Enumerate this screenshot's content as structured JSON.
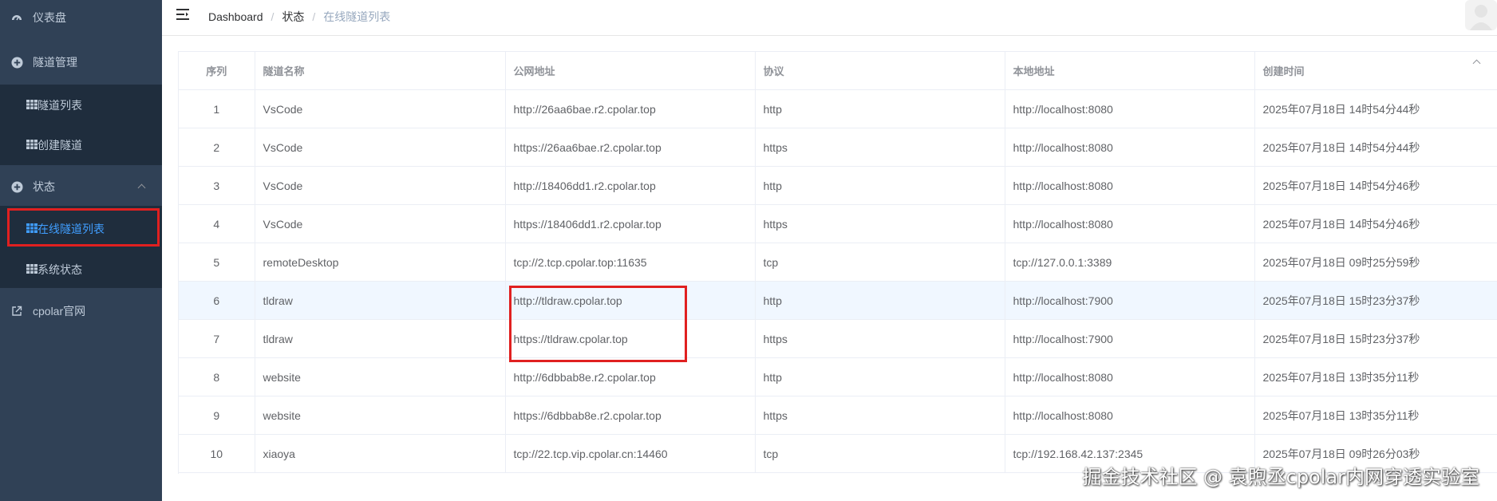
{
  "sidebar": {
    "dashboard": "仪表盘",
    "tunnel_mgmt": "隧道管理",
    "tunnel_list": "隧道列表",
    "create_tunnel": "创建隧道",
    "status": "状态",
    "online_tunnels": "在线隧道列表",
    "system_status": "系统状态",
    "official_site": "cpolar官网"
  },
  "breadcrumb": [
    "Dashboard",
    "状态",
    "在线隧道列表"
  ],
  "table": {
    "headers": [
      "序列",
      "隧道名称",
      "公网地址",
      "协议",
      "本地地址",
      "创建时间"
    ],
    "rows": [
      [
        "1",
        "VsCode",
        "http://26aa6bae.r2.cpolar.top",
        "http",
        "http://localhost:8080",
        "2025年07月18日 14时54分44秒"
      ],
      [
        "2",
        "VsCode",
        "https://26aa6bae.r2.cpolar.top",
        "https",
        "http://localhost:8080",
        "2025年07月18日 14时54分44秒"
      ],
      [
        "3",
        "VsCode",
        "http://18406dd1.r2.cpolar.top",
        "http",
        "http://localhost:8080",
        "2025年07月18日 14时54分46秒"
      ],
      [
        "4",
        "VsCode",
        "https://18406dd1.r2.cpolar.top",
        "https",
        "http://localhost:8080",
        "2025年07月18日 14时54分46秒"
      ],
      [
        "5",
        "remoteDesktop",
        "tcp://2.tcp.cpolar.top:11635",
        "tcp",
        "tcp://127.0.0.1:3389",
        "2025年07月18日 09时25分59秒"
      ],
      [
        "6",
        "tldraw",
        "http://tldraw.cpolar.top",
        "http",
        "http://localhost:7900",
        "2025年07月18日 15时23分37秒"
      ],
      [
        "7",
        "tldraw",
        "https://tldraw.cpolar.top",
        "https",
        "http://localhost:7900",
        "2025年07月18日 15时23分37秒"
      ],
      [
        "8",
        "website",
        "http://6dbbab8e.r2.cpolar.top",
        "http",
        "http://localhost:8080",
        "2025年07月18日 13时35分11秒"
      ],
      [
        "9",
        "website",
        "https://6dbbab8e.r2.cpolar.top",
        "https",
        "http://localhost:8080",
        "2025年07月18日 13时35分11秒"
      ],
      [
        "10",
        "xiaoya",
        "tcp://22.tcp.vip.cpolar.cn:14460",
        "tcp",
        "tcp://192.168.42.137:2345",
        "2025年07月18日 09时26分03秒"
      ]
    ]
  },
  "watermark": "掘金技术社区 @ 袁煦丞cpolar内网穿透实验室",
  "colors": {
    "sidebar_bg": "#304156",
    "submenu_bg": "#1f2d3d",
    "active": "#409eff",
    "highlight": "#e02020"
  }
}
